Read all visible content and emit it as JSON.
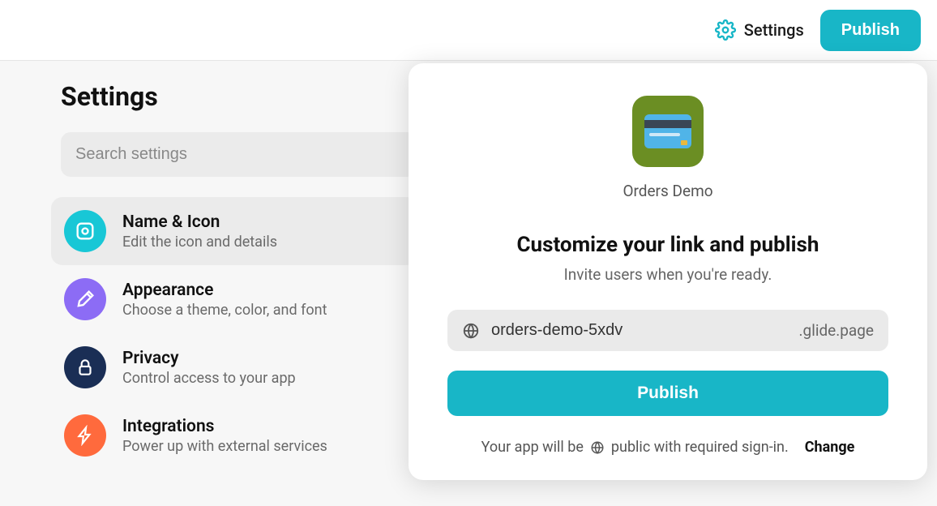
{
  "topbar": {
    "settings_label": "Settings",
    "publish_label": "Publish"
  },
  "sidebar": {
    "title": "Settings",
    "search_placeholder": "Search settings",
    "items": [
      {
        "title": "Name & Icon",
        "desc": "Edit the icon and details"
      },
      {
        "title": "Appearance",
        "desc": "Choose a theme, color, and font"
      },
      {
        "title": "Privacy",
        "desc": "Control access to your app"
      },
      {
        "title": "Integrations",
        "desc": "Power up with external services"
      }
    ]
  },
  "popover": {
    "app_name": "Orders Demo",
    "title": "Customize your link and publish",
    "subtitle": "Invite users when you're ready.",
    "link_value": "orders-demo-5xdv",
    "link_suffix": ".glide.page",
    "publish_label": "Publish",
    "visibility_prefix": "Your app will be",
    "visibility_text": "public with required sign-in.",
    "change_label": "Change"
  }
}
